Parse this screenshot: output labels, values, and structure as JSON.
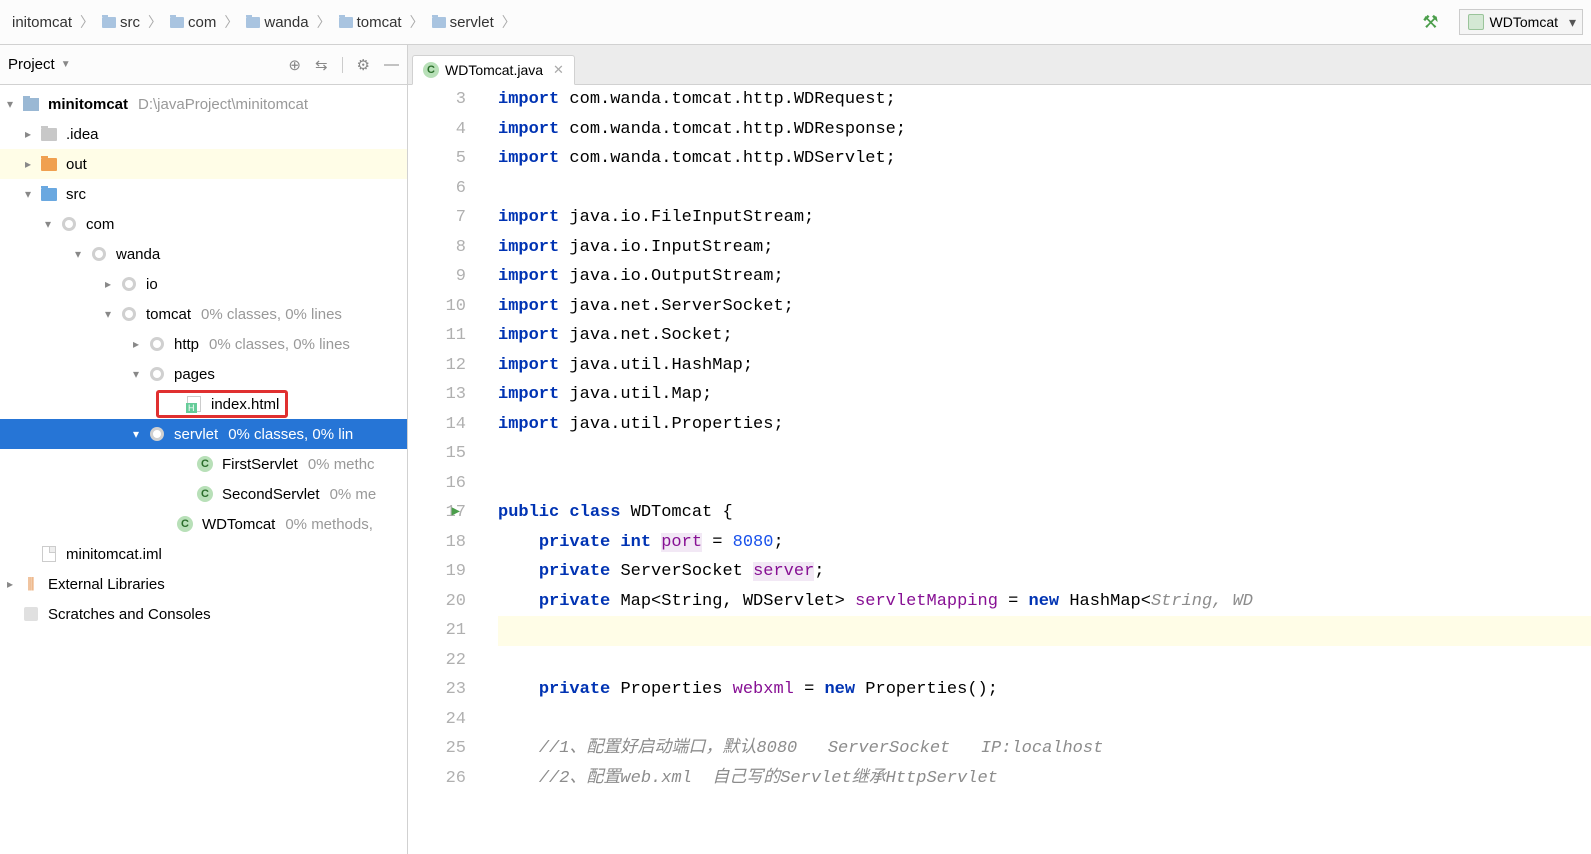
{
  "breadcrumbs": [
    "initomcat",
    "src",
    "com",
    "wanda",
    "tomcat",
    "servlet"
  ],
  "runConfig": "WDTomcat",
  "projectPanel": {
    "title": "Project",
    "root": {
      "name": "minitomcat",
      "path": "D:\\javaProject\\minitomcat"
    },
    "idea": ".idea",
    "out": "out",
    "src": "src",
    "com": "com",
    "wanda": "wanda",
    "io": "io",
    "tomcat": "tomcat",
    "tomcatMeta": "0% classes, 0% lines",
    "http": "http",
    "httpMeta": "0% classes, 0% lines",
    "pages": "pages",
    "indexHtml": "index.html",
    "servlet": "servlet",
    "servletMeta": "0% classes, 0% lin",
    "firstServlet": "FirstServlet",
    "firstServletMeta": "0% methc",
    "secondServlet": "SecondServlet",
    "secondServletMeta": "0% me",
    "wdTomcat": "WDTomcat",
    "wdTomcatMeta": "0% methods,",
    "iml": "minitomcat.iml",
    "externalLibs": "External Libraries",
    "scratches": "Scratches and Consoles"
  },
  "tab": {
    "title": "WDTomcat.java"
  },
  "code": {
    "startLine": 3,
    "lines": [
      {
        "n": 3,
        "segs": [
          {
            "t": "import ",
            "c": "kw"
          },
          {
            "t": "com.wanda.tomcat.http.WDRequest;",
            "c": ""
          }
        ]
      },
      {
        "n": 4,
        "segs": [
          {
            "t": "import ",
            "c": "kw"
          },
          {
            "t": "com.wanda.tomcat.http.WDResponse;",
            "c": ""
          }
        ]
      },
      {
        "n": 5,
        "segs": [
          {
            "t": "import ",
            "c": "kw"
          },
          {
            "t": "com.wanda.tomcat.http.WDServlet;",
            "c": ""
          }
        ]
      },
      {
        "n": 6,
        "segs": []
      },
      {
        "n": 7,
        "segs": [
          {
            "t": "import ",
            "c": "kw"
          },
          {
            "t": "java.io.FileInputStream;",
            "c": ""
          }
        ]
      },
      {
        "n": 8,
        "segs": [
          {
            "t": "import ",
            "c": "kw"
          },
          {
            "t": "java.io.InputStream;",
            "c": ""
          }
        ]
      },
      {
        "n": 9,
        "segs": [
          {
            "t": "import ",
            "c": "kw"
          },
          {
            "t": "java.io.OutputStream;",
            "c": ""
          }
        ]
      },
      {
        "n": 10,
        "segs": [
          {
            "t": "import ",
            "c": "kw"
          },
          {
            "t": "java.net.ServerSocket;",
            "c": ""
          }
        ]
      },
      {
        "n": 11,
        "segs": [
          {
            "t": "import ",
            "c": "kw"
          },
          {
            "t": "java.net.Socket;",
            "c": ""
          }
        ]
      },
      {
        "n": 12,
        "segs": [
          {
            "t": "import ",
            "c": "kw"
          },
          {
            "t": "java.util.HashMap;",
            "c": ""
          }
        ]
      },
      {
        "n": 13,
        "segs": [
          {
            "t": "import ",
            "c": "kw"
          },
          {
            "t": "java.util.Map;",
            "c": ""
          }
        ]
      },
      {
        "n": 14,
        "segs": [
          {
            "t": "import ",
            "c": "kw"
          },
          {
            "t": "java.util.Properties;",
            "c": ""
          }
        ]
      },
      {
        "n": 15,
        "segs": []
      },
      {
        "n": 16,
        "segs": []
      },
      {
        "n": 17,
        "play": true,
        "segs": [
          {
            "t": "public class ",
            "c": "kw"
          },
          {
            "t": "WDTomcat ",
            "c": ""
          },
          {
            "t": "{",
            "c": ""
          }
        ]
      },
      {
        "n": 18,
        "segs": [
          {
            "t": "    ",
            "c": ""
          },
          {
            "t": "private int ",
            "c": "kw"
          },
          {
            "t": "port",
            "c": "fld fld-bg"
          },
          {
            "t": " = ",
            "c": ""
          },
          {
            "t": "8080",
            "c": "literal"
          },
          {
            "t": ";",
            "c": ""
          }
        ]
      },
      {
        "n": 19,
        "segs": [
          {
            "t": "    ",
            "c": ""
          },
          {
            "t": "private ",
            "c": "kw"
          },
          {
            "t": "ServerSocket ",
            "c": ""
          },
          {
            "t": "server",
            "c": "fld fld-bg"
          },
          {
            "t": ";",
            "c": ""
          }
        ]
      },
      {
        "n": 20,
        "segs": [
          {
            "t": "    ",
            "c": ""
          },
          {
            "t": "private ",
            "c": "kw"
          },
          {
            "t": "Map<String, WDServlet> ",
            "c": ""
          },
          {
            "t": "servletMapping",
            "c": "fld"
          },
          {
            "t": " = ",
            "c": ""
          },
          {
            "t": "new ",
            "c": "kw"
          },
          {
            "t": "HashMap<",
            "c": ""
          },
          {
            "t": "String, WD",
            "c": "cmt"
          }
        ]
      },
      {
        "n": 21,
        "cursor": true,
        "segs": []
      },
      {
        "n": 22,
        "segs": []
      },
      {
        "n": 23,
        "segs": [
          {
            "t": "    ",
            "c": ""
          },
          {
            "t": "private ",
            "c": "kw"
          },
          {
            "t": "Properties ",
            "c": ""
          },
          {
            "t": "webxml",
            "c": "fld"
          },
          {
            "t": " = ",
            "c": ""
          },
          {
            "t": "new ",
            "c": "kw"
          },
          {
            "t": "Properties();",
            "c": ""
          }
        ]
      },
      {
        "n": 24,
        "segs": []
      },
      {
        "n": 25,
        "segs": [
          {
            "t": "    ",
            "c": ""
          },
          {
            "t": "//1、配置好启动端口，默认8080   ServerSocket   IP:localhost",
            "c": "cmt"
          }
        ]
      },
      {
        "n": 26,
        "segs": [
          {
            "t": "    ",
            "c": ""
          },
          {
            "t": "//2、配置web.xml  自己写的Servlet继承HttpServlet",
            "c": "cmt"
          }
        ]
      }
    ]
  }
}
